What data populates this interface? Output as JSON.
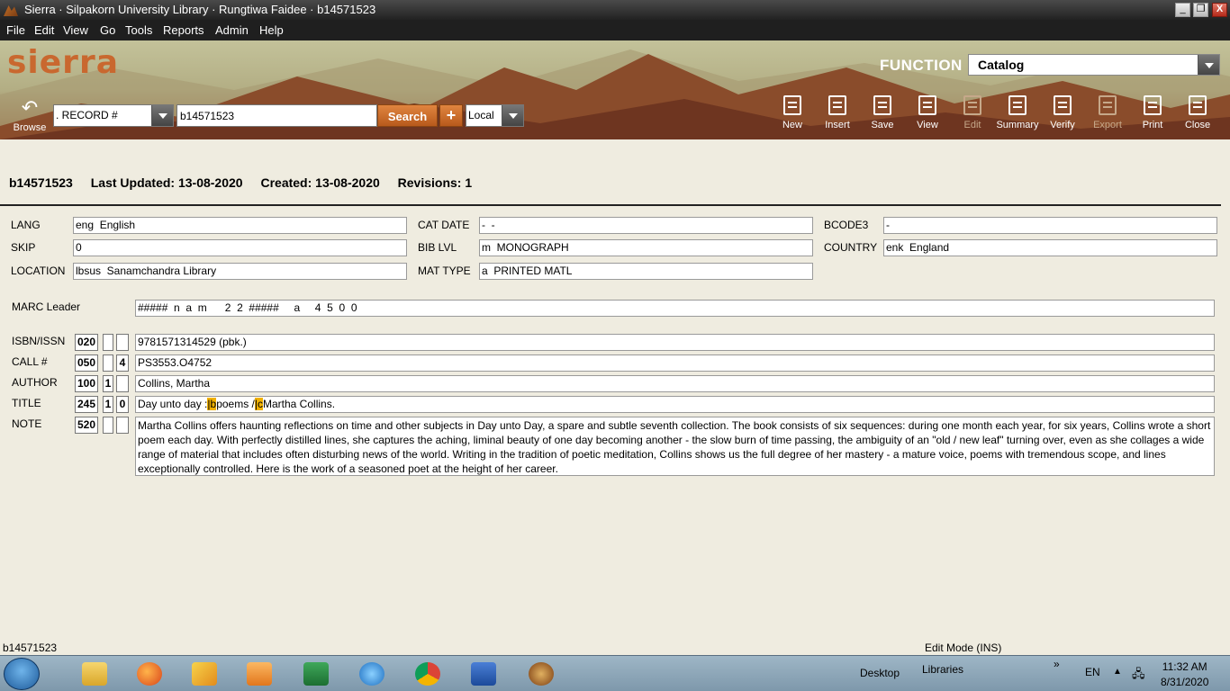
{
  "window": {
    "title": "Sierra · Silpakorn University Library · Rungtiwa Faidee · b14571523",
    "min": "_",
    "max": "❐",
    "close": "X"
  },
  "menu": [
    "File",
    "Edit",
    "View",
    "Go",
    "Tools",
    "Reports",
    "Admin",
    "Help"
  ],
  "banner": {
    "logo": "sierra",
    "function_label": "FUNCTION",
    "function_value": "Catalog"
  },
  "search": {
    "browse_label": "Browse",
    "index": ". RECORD #",
    "query": "b14571523",
    "button": "Search",
    "plus": "+",
    "scope": "Local"
  },
  "toolbar": [
    {
      "label": "New",
      "enabled": true
    },
    {
      "label": "Insert",
      "enabled": true
    },
    {
      "label": "Save",
      "enabled": true
    },
    {
      "label": "View",
      "enabled": true
    },
    {
      "label": "Edit",
      "enabled": false
    },
    {
      "label": "Summary",
      "enabled": true
    },
    {
      "label": "Verify",
      "enabled": true
    },
    {
      "label": "Export",
      "enabled": false
    },
    {
      "label": "Print",
      "enabled": true
    },
    {
      "label": "Close",
      "enabled": true
    }
  ],
  "record": {
    "id": "b14571523",
    "updated": "Last Updated: 13-08-2020",
    "created": "Created: 13-08-2020",
    "revisions": "Revisions: 1"
  },
  "fixed": {
    "lang": {
      "label": "LANG",
      "value": "eng  English"
    },
    "skip": {
      "label": "SKIP",
      "value": "0"
    },
    "location": {
      "label": "LOCATION",
      "value": "lbsus  Sanamchandra Library"
    },
    "catdate": {
      "label": "CAT DATE",
      "value": "-  -"
    },
    "biblvl": {
      "label": "BIB LVL",
      "value": "m  MONOGRAPH"
    },
    "mattype": {
      "label": "MAT TYPE",
      "value": "a  PRINTED MATL"
    },
    "bcode3": {
      "label": "BCODE3",
      "value": "-"
    },
    "country": {
      "label": "COUNTRY",
      "value": "enk  England"
    }
  },
  "leader": {
    "label": "MARC Leader",
    "value": "#####  n  a  m      2  2  #####     a     4  5  0  0"
  },
  "varfields": {
    "isbn": {
      "label": "ISBN/ISSN",
      "tag": "020",
      "ind1": "",
      "ind2": "",
      "value": "9781571314529 (pbk.)"
    },
    "call": {
      "label": "CALL #",
      "tag": "050",
      "ind1": "",
      "ind2": "4",
      "value": "PS3553.O4752"
    },
    "author": {
      "label": "AUTHOR",
      "tag": "100",
      "ind1": "1",
      "ind2": "",
      "value": "Collins, Martha"
    },
    "title": {
      "label": "TITLE",
      "tag": "245",
      "ind1": "1",
      "ind2": "0",
      "part1": "Day unto day :",
      "sf1": "|b",
      "part2": "poems /",
      "sf2": "|c",
      "part3": "Martha Collins."
    },
    "note": {
      "label": "NOTE",
      "tag": "520",
      "ind1": "",
      "ind2": "",
      "value": "Martha Collins offers haunting reflections on time and other subjects in Day unto Day, a spare and subtle seventh collection. The book consists of six sequences: during one month each year, for six years, Collins wrote a short poem each day. With perfectly distilled lines, she captures the aching, liminal beauty of one day becoming another - the slow burn of time passing, the ambiguity of an \"old / new leaf\" turning over, even as she collages a wide range of material that includes often disturbing news of the world. Writing in the tradition of poetic meditation, Collins shows us the full degree of her mastery - a mature voice, poems with tremendous scope, and lines exceptionally controlled. Here is the work of a seasoned poet at the height of her career."
    }
  },
  "status": {
    "left": "b14571523",
    "right": "Edit Mode (INS)"
  },
  "taskbar": {
    "desktop": "Desktop",
    "libraries": "Libraries",
    "chevron": "»",
    "lang": "EN",
    "time": "11:32 AM",
    "date": "8/31/2020"
  }
}
